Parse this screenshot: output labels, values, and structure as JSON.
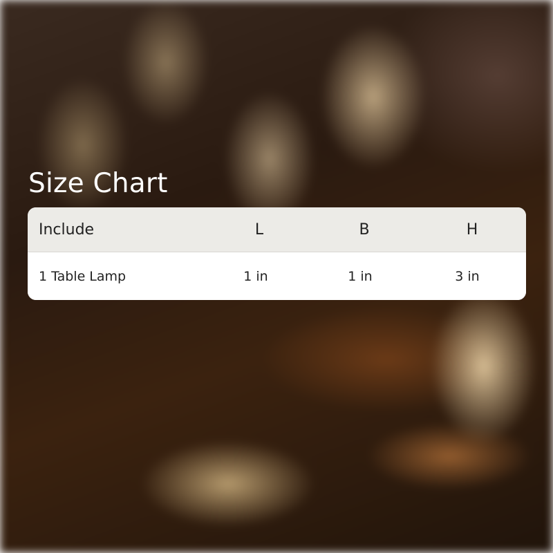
{
  "title": "Size Chart",
  "table": {
    "headers": [
      "Include",
      "L",
      "B",
      "H"
    ],
    "rows": [
      [
        "1 Table Lamp",
        "1 in",
        "1 in",
        "3 in"
      ]
    ]
  },
  "colors": {
    "header_bg": "#ecebe7",
    "body_bg": "#ffffff",
    "text": "#222222",
    "title": "#ffffff"
  }
}
